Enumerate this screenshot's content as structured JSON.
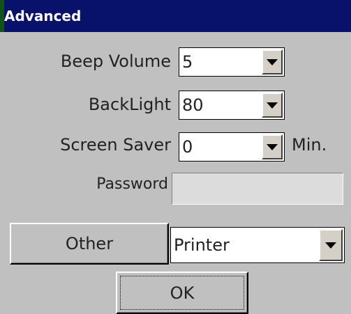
{
  "window": {
    "title": "Advanced"
  },
  "settings": {
    "beep_volume": {
      "label": "Beep Volume",
      "value": "5"
    },
    "backlight": {
      "label": "BackLight",
      "value": "80"
    },
    "screen_saver": {
      "label": "Screen Saver",
      "value": "0",
      "unit": "Min."
    },
    "password": {
      "label": "Password",
      "value": ""
    }
  },
  "other": {
    "button_label": "Other",
    "selected": "Printer"
  },
  "ok_label": "OK",
  "colors": {
    "titlebar": "#08126a",
    "dialog_bg": "#c0c0c0",
    "field_bg": "#ffffff"
  }
}
